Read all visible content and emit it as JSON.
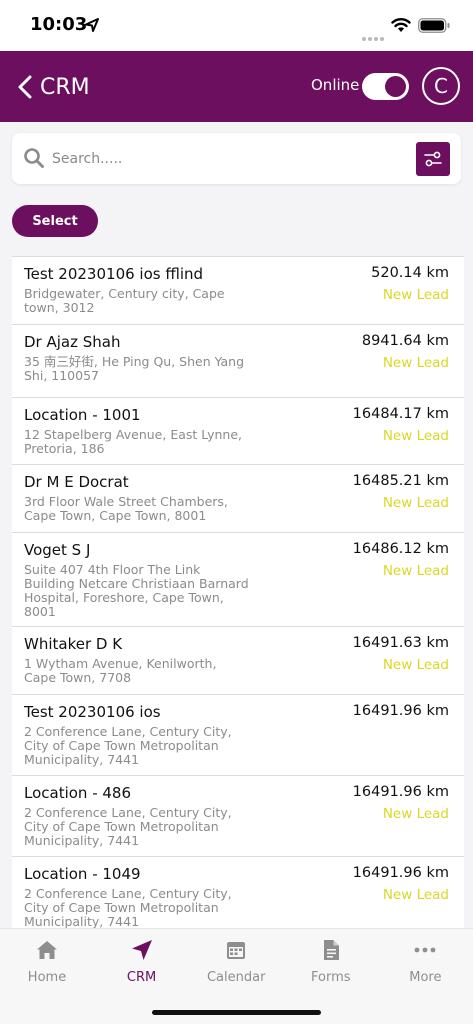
{
  "status_bar": {
    "time": "10:03",
    "icons": [
      "location-arrow-icon",
      "cellular-dots-icon",
      "wifi-icon",
      "battery-icon"
    ]
  },
  "header": {
    "back_icon": "chevron-left-icon",
    "title": "CRM",
    "online_label": "Online",
    "online_toggle": true,
    "avatar_initial": "C"
  },
  "search": {
    "placeholder": "Search.....",
    "value": "",
    "icon": "search-icon",
    "filter_icon": "sliders-icon"
  },
  "select_button": "Select",
  "leads": [
    {
      "name": "Test 20230106 ios fflind",
      "address": "Bridgewater, Century city, Cape town, 3012",
      "distance": "520.14 km",
      "status": "New Lead"
    },
    {
      "name": "Dr Ajaz Shah",
      "address": "35 南三好街, He Ping Qu, Shen Yang Shi, 110057",
      "distance": "8941.64 km",
      "status": "New Lead"
    },
    {
      "name": "Location - 1001",
      "address": "12 Stapelberg Avenue, East Lynne, Pretoria, 186",
      "distance": "16484.17 km",
      "status": "New Lead"
    },
    {
      "name": "Dr M E Docrat",
      "address": "3rd Floor  Wale Street Chambers, Cape Town, Cape Town, 8001",
      "distance": "16485.21 km",
      "status": "New Lead"
    },
    {
      "name": "Voget S J",
      "address": "Suite 407 4th Floor The Link Building  Netcare Christiaan Barnard Hospital, Foreshore, Cape Town, 8001",
      "distance": "16486.12 km",
      "status": "New Lead"
    },
    {
      "name": "Whitaker D K",
      "address": "1 Wytham Avenue, Kenilworth, Cape Town, 7708",
      "distance": "16491.63 km",
      "status": "New Lead"
    },
    {
      "name": "Test 20230106 ios",
      "address": "2 Conference Lane, Century City, City of Cape Town Metropolitan Municipality, 7441",
      "distance": "16491.96 km",
      "status": ""
    },
    {
      "name": "Location - 486",
      "address": "2 Conference Lane, Century City, City of Cape Town Metropolitan Municipality, 7441",
      "distance": "16491.96 km",
      "status": "New Lead"
    },
    {
      "name": "Location - 1049",
      "address": "2 Conference Lane, Century City, City of Cape Town Metropolitan Municipality, 7441",
      "distance": "16491.96 km",
      "status": "New Lead"
    }
  ],
  "tabs": [
    {
      "label": "Home",
      "icon": "home-icon",
      "active": false
    },
    {
      "label": "CRM",
      "icon": "navigation-arrow-icon",
      "active": true
    },
    {
      "label": "Calendar",
      "icon": "calendar-icon",
      "active": false
    },
    {
      "label": "Forms",
      "icon": "document-icon",
      "active": false
    },
    {
      "label": "More",
      "icon": "more-dots-icon",
      "active": false
    }
  ],
  "colors": {
    "brand": "#6b0f5e",
    "status_new_lead": "#d9d826",
    "address_text": "#8b8b8b",
    "tab_inactive": "#8e8e8e"
  }
}
